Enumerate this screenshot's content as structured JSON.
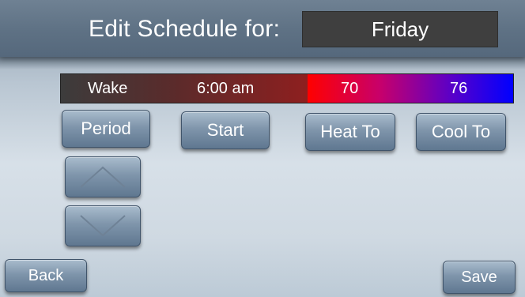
{
  "header": {
    "title": "Edit Schedule for:",
    "day": "Friday"
  },
  "schedule_row": {
    "period": "Wake",
    "start": "6:00 am",
    "heat_to": "70",
    "cool_to": "76"
  },
  "buttons": {
    "period": "Period",
    "start": "Start",
    "heat_to": "Heat To",
    "cool_to": "Cool To",
    "back": "Back",
    "save": "Save"
  },
  "icons": {
    "up": "chevron-up-icon",
    "down": "chevron-down-icon"
  },
  "colors": {
    "heat": "#ff0000",
    "cool": "#0000ff",
    "header": "#5e7184",
    "day_box": "#3f3f3f"
  }
}
